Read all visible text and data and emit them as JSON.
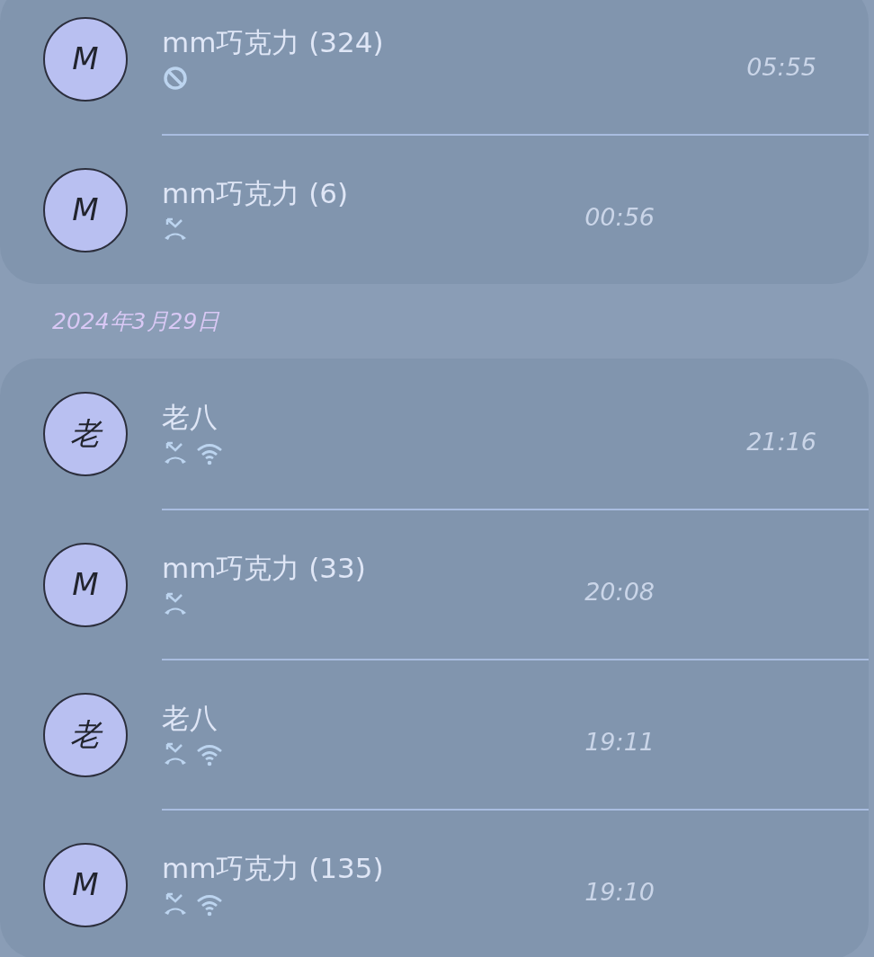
{
  "groups": [
    {
      "calls": [
        {
          "avatar": "M",
          "name": "mm巧克力 (324)",
          "kind": "blocked",
          "wifi": false,
          "time": "05:55"
        },
        {
          "avatar": "M",
          "name": "mm巧克力 (6)",
          "kind": "missed",
          "wifi": false,
          "time": "00:56"
        }
      ]
    },
    {
      "date": "2024年3月29日",
      "calls": [
        {
          "avatar": "老",
          "name": "老八",
          "kind": "missed",
          "wifi": true,
          "time": "21:16"
        },
        {
          "avatar": "M",
          "name": "mm巧克力 (33)",
          "kind": "missed",
          "wifi": false,
          "time": "20:08"
        },
        {
          "avatar": "老",
          "name": "老八",
          "kind": "missed",
          "wifi": true,
          "time": "19:11"
        },
        {
          "avatar": "M",
          "name": "mm巧克力 (135)",
          "kind": "missed",
          "wifi": true,
          "time": "19:10"
        }
      ]
    }
  ]
}
